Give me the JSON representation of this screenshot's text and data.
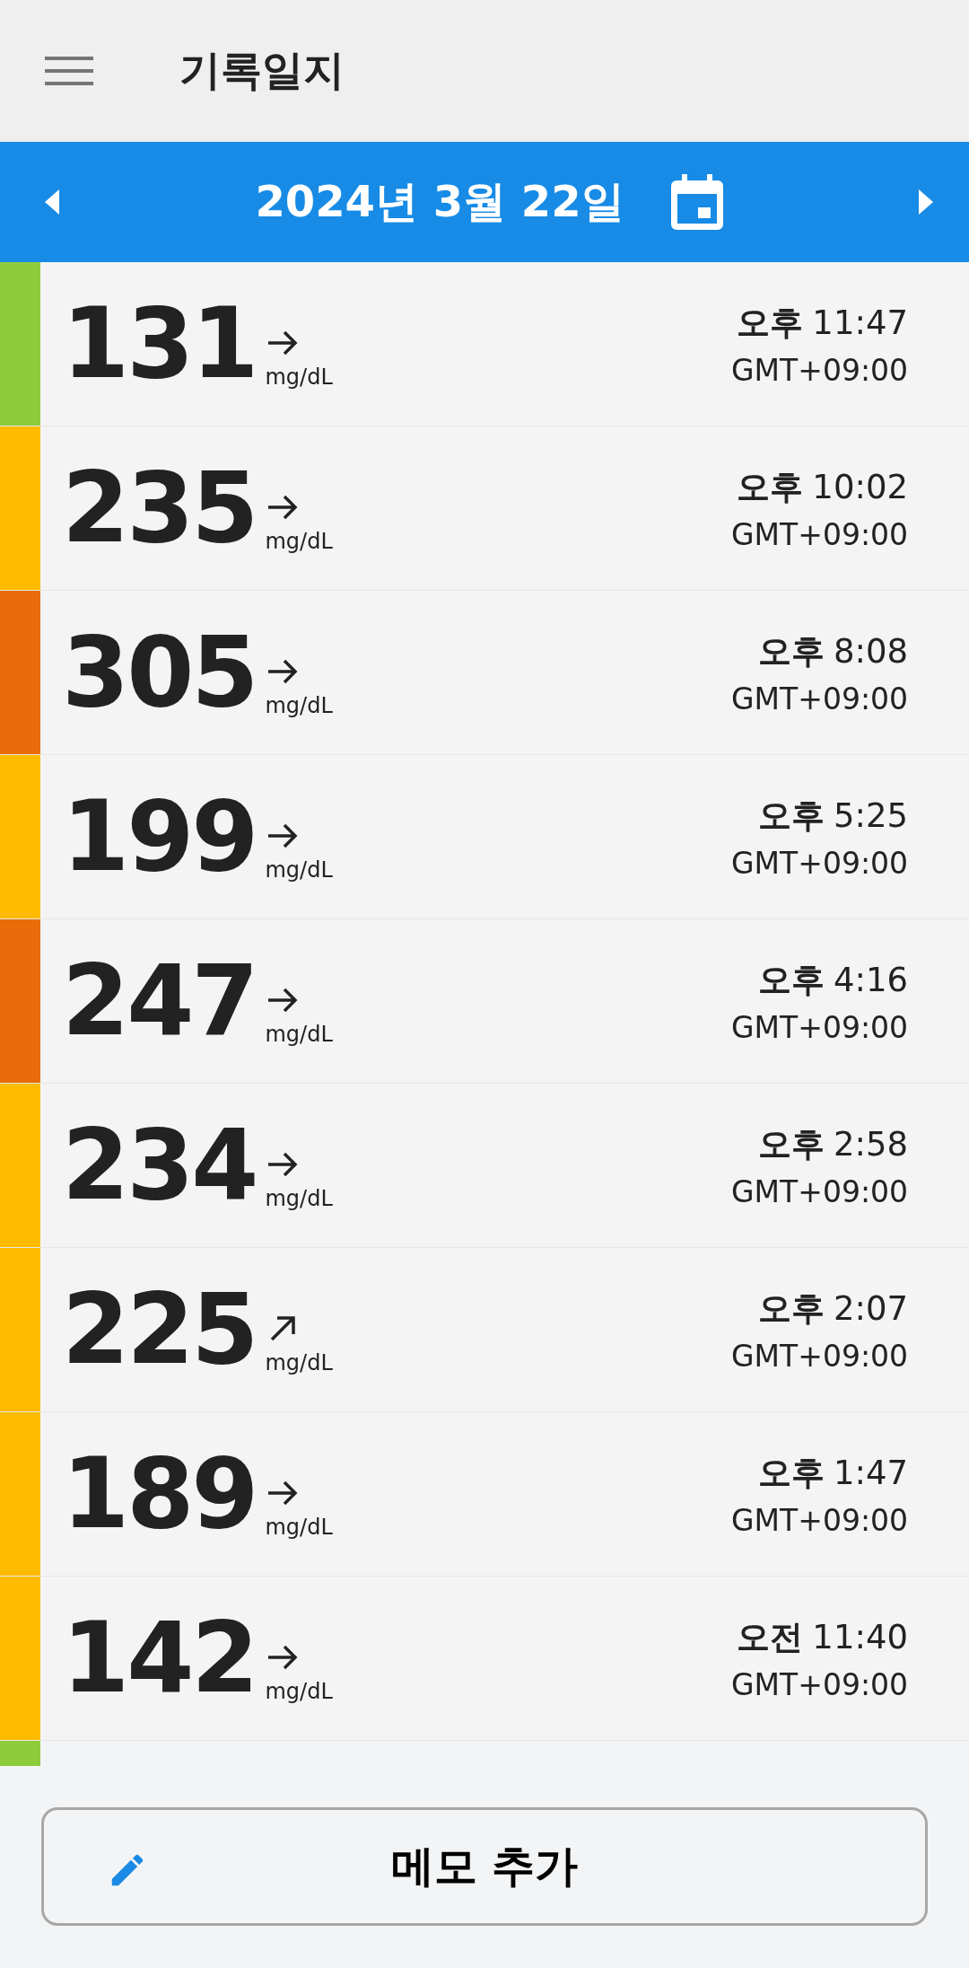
{
  "app_bar": {
    "title": "기록일지"
  },
  "date_bar": {
    "date": "2024년 3월 22일"
  },
  "readings": [
    {
      "value": "131",
      "unit": "mg/dL",
      "kind": "flat",
      "color": "#8fcc3c",
      "period": "오후",
      "time": "11:47",
      "zone": "GMT+09:00"
    },
    {
      "value": "235",
      "unit": "mg/dL",
      "kind": "flat",
      "color": "#ffbb00",
      "period": "오후",
      "time": "10:02",
      "zone": "GMT+09:00"
    },
    {
      "value": "305",
      "unit": "mg/dL",
      "kind": "flat",
      "color": "#ea6b0a",
      "period": "오후",
      "time": "8:08",
      "zone": "GMT+09:00"
    },
    {
      "value": "199",
      "unit": "mg/dL",
      "kind": "flat",
      "color": "#ffbb00",
      "period": "오후",
      "time": "5:25",
      "zone": "GMT+09:00"
    },
    {
      "value": "247",
      "unit": "mg/dL",
      "kind": "flat",
      "color": "#ea6b0a",
      "period": "오후",
      "time": "4:16",
      "zone": "GMT+09:00"
    },
    {
      "value": "234",
      "unit": "mg/dL",
      "kind": "flat",
      "color": "#ffbb00",
      "period": "오후",
      "time": "2:58",
      "zone": "GMT+09:00"
    },
    {
      "value": "225",
      "unit": "mg/dL",
      "kind": "rising",
      "color": "#ffbb00",
      "period": "오후",
      "time": "2:07",
      "zone": "GMT+09:00"
    },
    {
      "value": "189",
      "unit": "mg/dL",
      "kind": "flat",
      "color": "#ffbb00",
      "period": "오후",
      "time": "1:47",
      "zone": "GMT+09:00"
    },
    {
      "value": "142",
      "unit": "mg/dL",
      "kind": "flat",
      "color": "#ffbb00",
      "period": "오전",
      "time": "11:40",
      "zone": "GMT+09:00"
    }
  ],
  "next_reading_strip": {
    "color": "#8fcc3c"
  },
  "memo_button": {
    "label": "메모 추가"
  }
}
